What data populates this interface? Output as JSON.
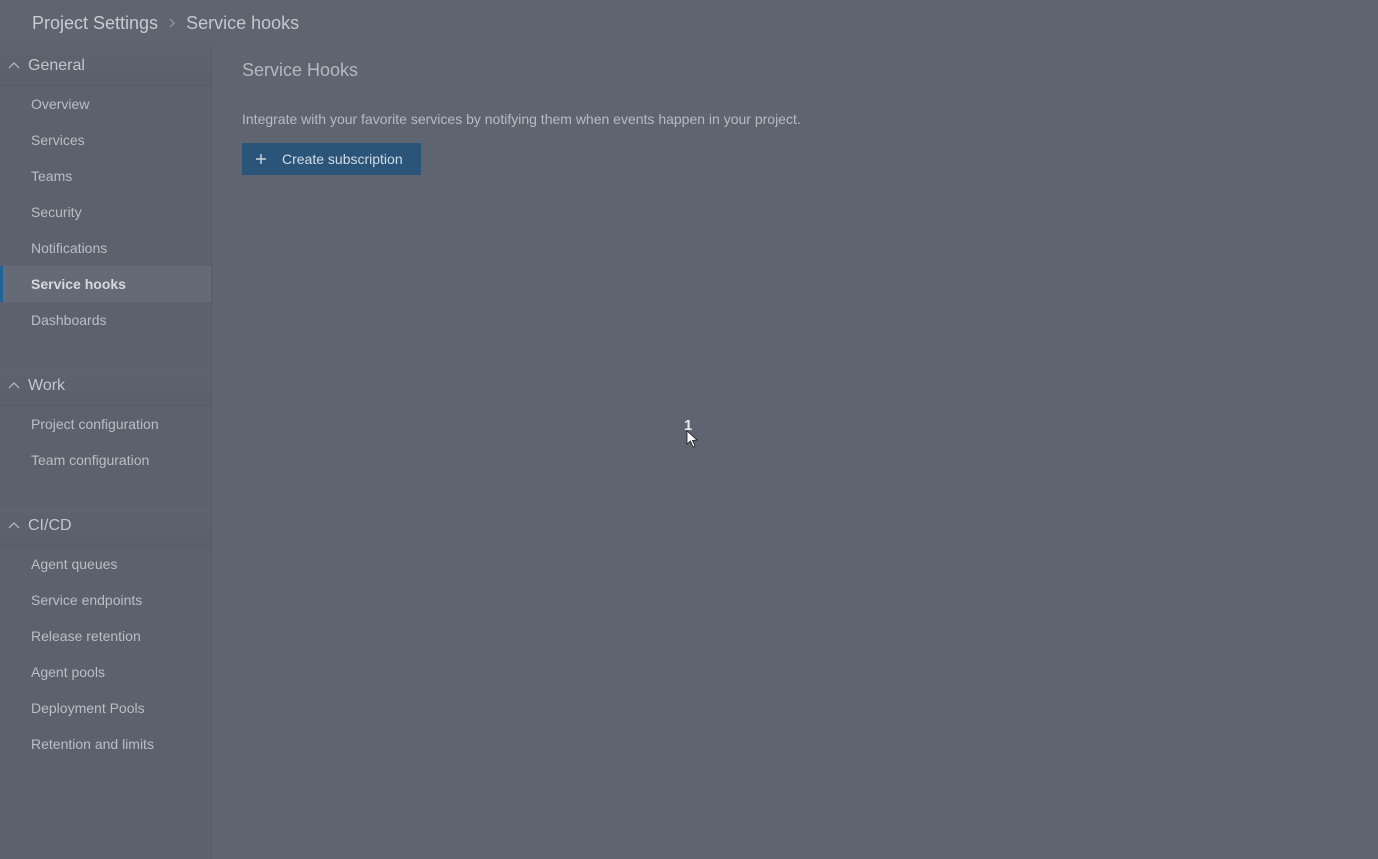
{
  "breadcrumb": {
    "root": "Project Settings",
    "current": "Service hooks"
  },
  "sidebar": {
    "sections": [
      {
        "title": "General",
        "items": [
          {
            "label": "Overview",
            "active": false
          },
          {
            "label": "Services",
            "active": false
          },
          {
            "label": "Teams",
            "active": false
          },
          {
            "label": "Security",
            "active": false
          },
          {
            "label": "Notifications",
            "active": false
          },
          {
            "label": "Service hooks",
            "active": true
          },
          {
            "label": "Dashboards",
            "active": false
          }
        ]
      },
      {
        "title": "Work",
        "items": [
          {
            "label": "Project configuration",
            "active": false
          },
          {
            "label": "Team configuration",
            "active": false
          }
        ]
      },
      {
        "title": "CI/CD",
        "items": [
          {
            "label": "Agent queues",
            "active": false
          },
          {
            "label": "Service endpoints",
            "active": false
          },
          {
            "label": "Release retention",
            "active": false
          },
          {
            "label": "Agent pools",
            "active": false
          },
          {
            "label": "Deployment Pools",
            "active": false
          },
          {
            "label": "Retention and limits",
            "active": false
          }
        ]
      }
    ]
  },
  "main": {
    "title": "Service Hooks",
    "description": "Integrate with your favorite services by notifying them when events happen in your project.",
    "create_label": "Create subscription"
  },
  "cursor": {
    "label": "1"
  }
}
